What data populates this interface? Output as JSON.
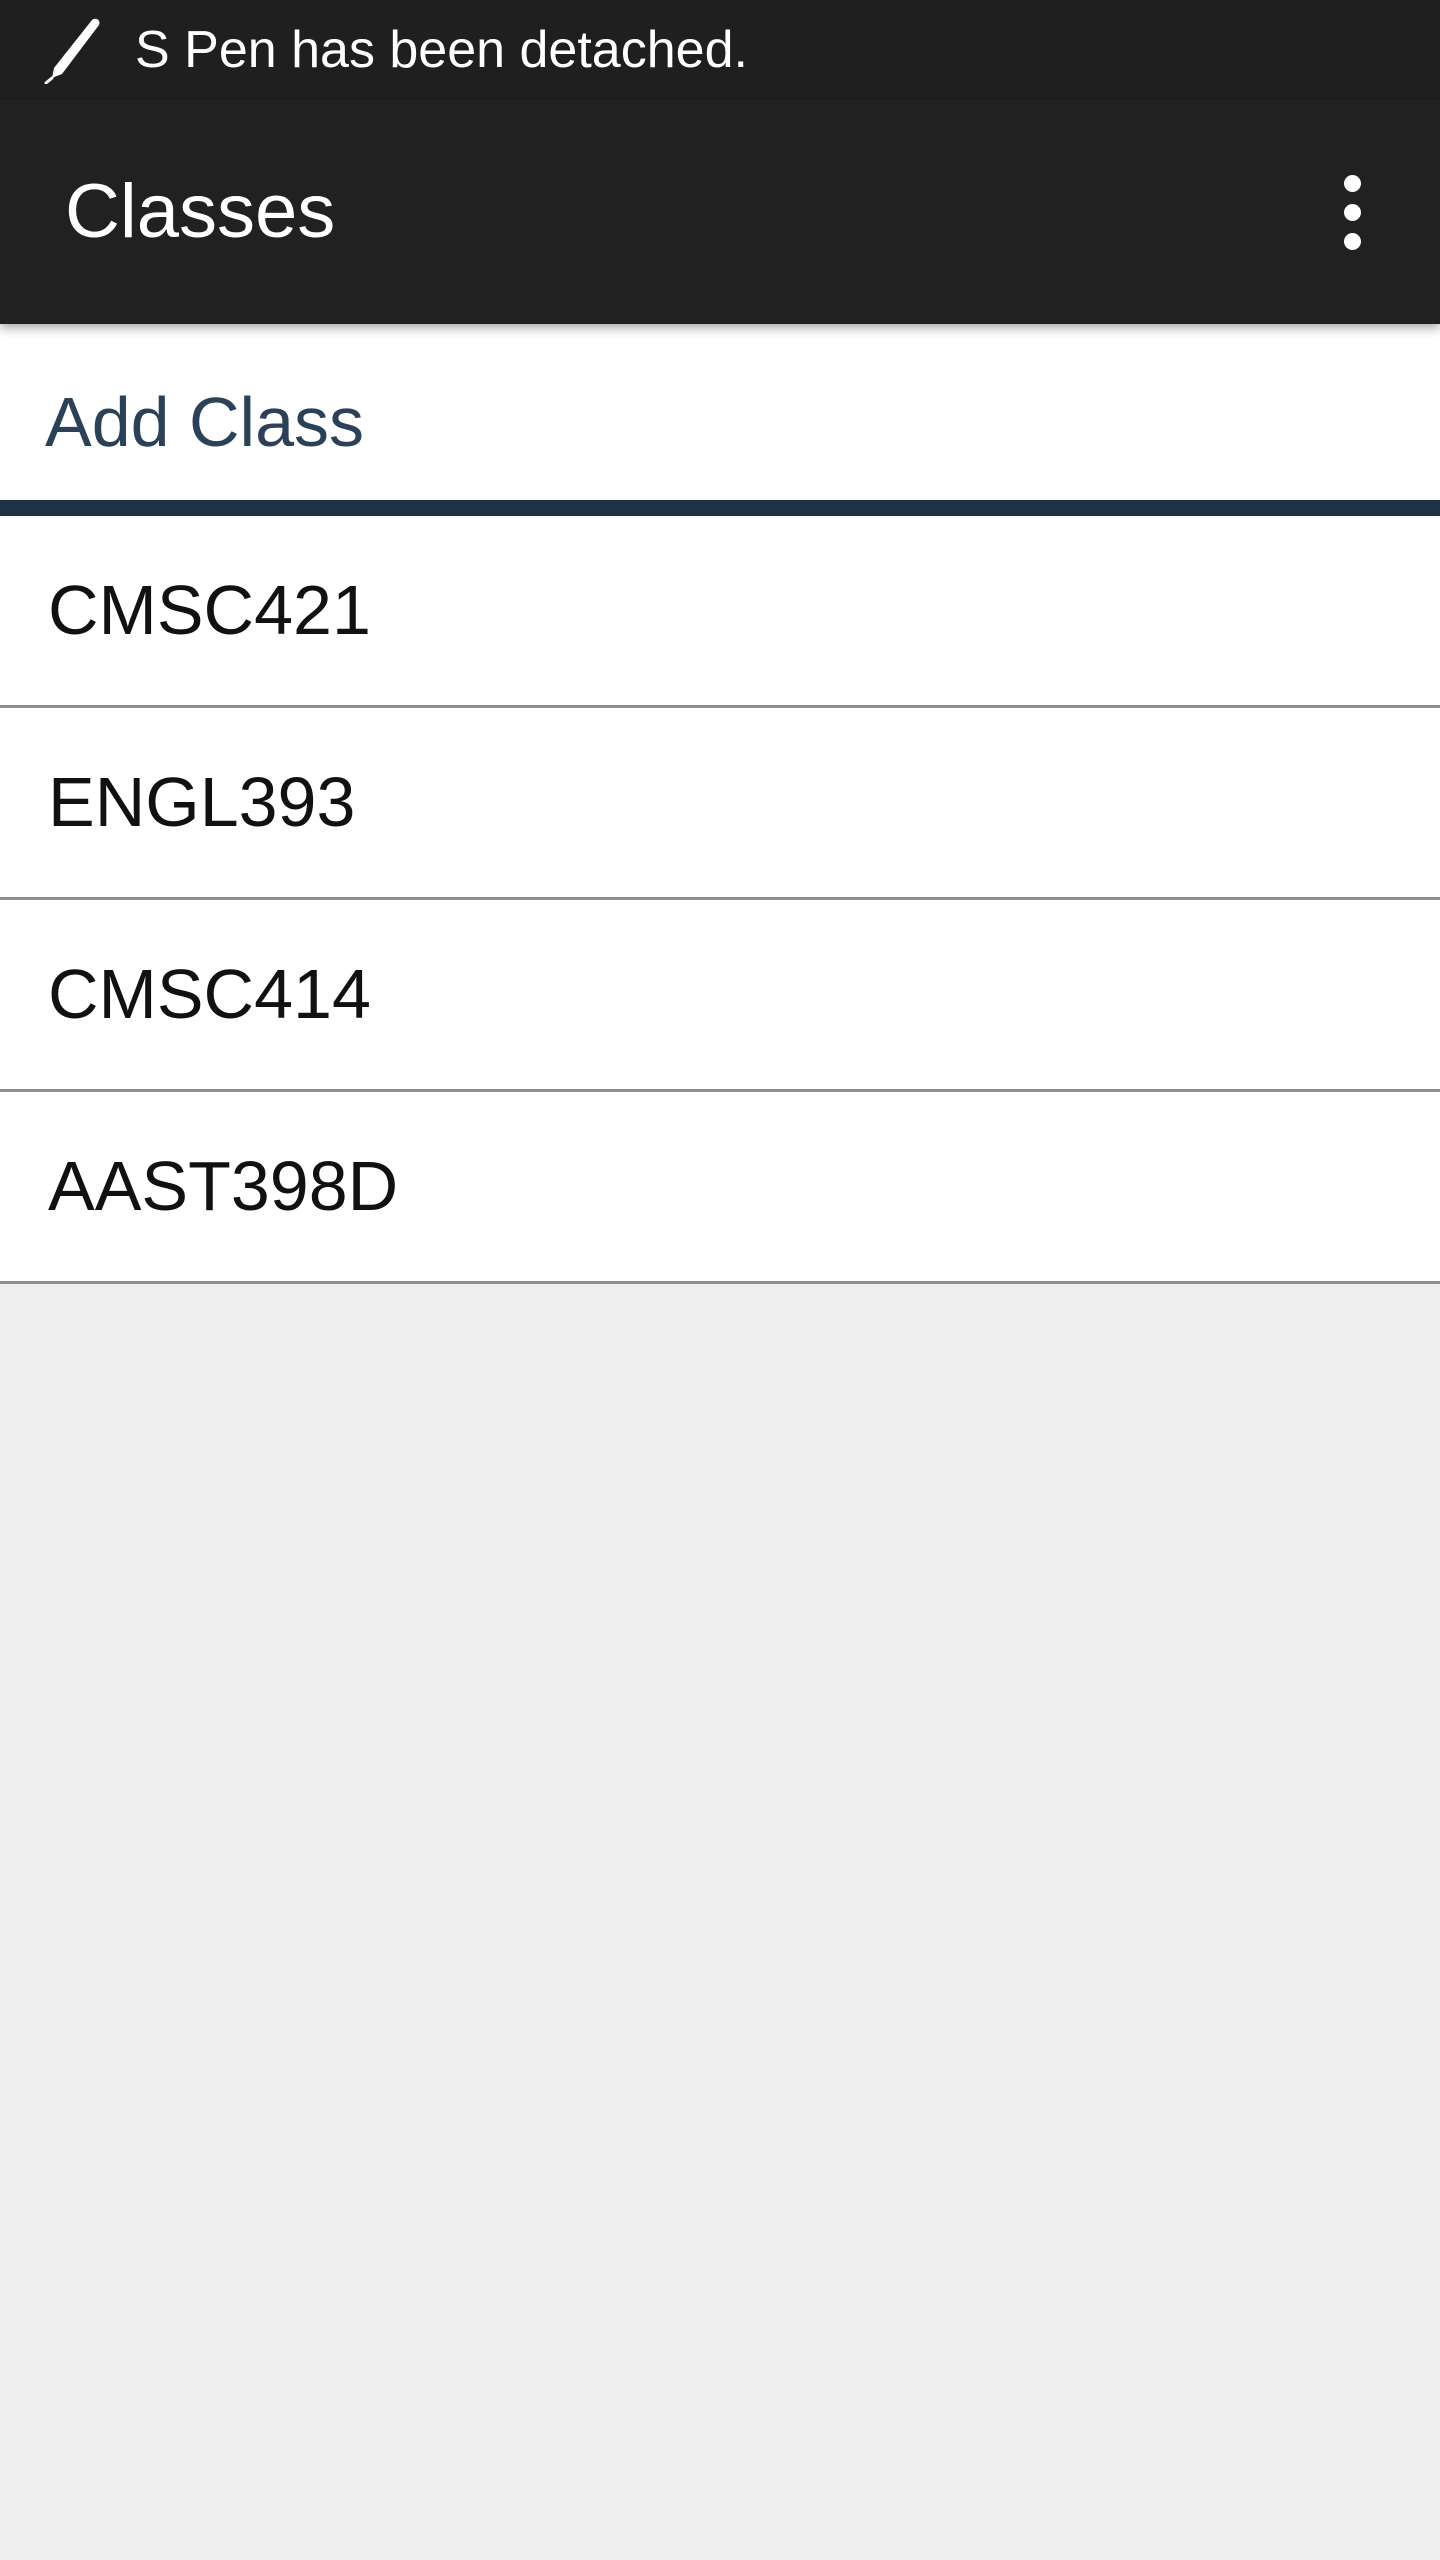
{
  "status_bar": {
    "icon": "pen-icon",
    "message": "S Pen has been detached."
  },
  "action_bar": {
    "title": "Classes",
    "overflow_icon": "more-vert-icon"
  },
  "add_class": {
    "label": "Add Class",
    "accent_color": "#2a4158",
    "underline_color": "#1e3147"
  },
  "classes": [
    {
      "name": "CMSC421"
    },
    {
      "name": "ENGL393"
    },
    {
      "name": "CMSC414"
    },
    {
      "name": "AAST398D"
    }
  ]
}
